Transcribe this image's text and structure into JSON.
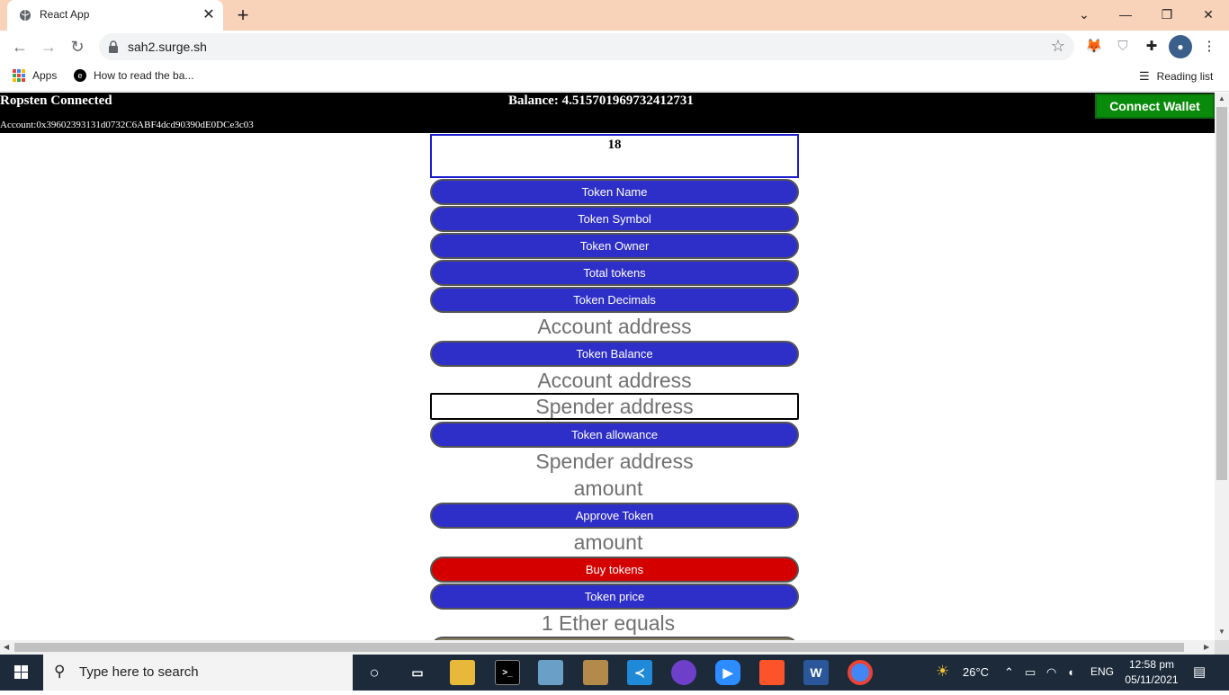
{
  "browser": {
    "tab_title": "React App",
    "url": "sah2.surge.sh",
    "bookmarks": {
      "apps": "Apps",
      "item1": "How to read the ba...",
      "reading_list": "Reading list"
    }
  },
  "header": {
    "network": "Ropsten Connected",
    "balance": "Balance: 4.515701969732412731",
    "account": "Account:0x39602393131d0732C6ABF4dcd90390dE0DCe3c03",
    "connect_label": "Connect Wallet"
  },
  "main": {
    "output_value": "18",
    "btn_token_name": "Token Name",
    "btn_token_symbol": "Token Symbol",
    "btn_token_owner": "Token Owner",
    "btn_total_tokens": "Total tokens",
    "btn_token_decimals": "Token Decimals",
    "placeholder_account1": "Account address",
    "btn_token_balance": "Token Balance",
    "placeholder_account2": "Account address",
    "placeholder_spender1": "Spender address",
    "btn_token_allowance": "Token allowance",
    "placeholder_spender2": "Spender address",
    "placeholder_amount1": "amount",
    "btn_approve_token": "Approve Token",
    "placeholder_amount2": "amount",
    "btn_buy_tokens": "Buy tokens",
    "btn_token_price": "Token price",
    "text_ether_equals": "1 Ether equals"
  },
  "taskbar": {
    "search_placeholder": "Type here to search",
    "temperature": "26°C",
    "language": "ENG",
    "time": "12:58 pm",
    "date": "05/11/2021"
  },
  "colors": {
    "button_blue": "#2e2ec8",
    "button_red": "#d40000",
    "connect_green": "#0a8a0a",
    "tabbar_bg": "#f8d2b9"
  }
}
